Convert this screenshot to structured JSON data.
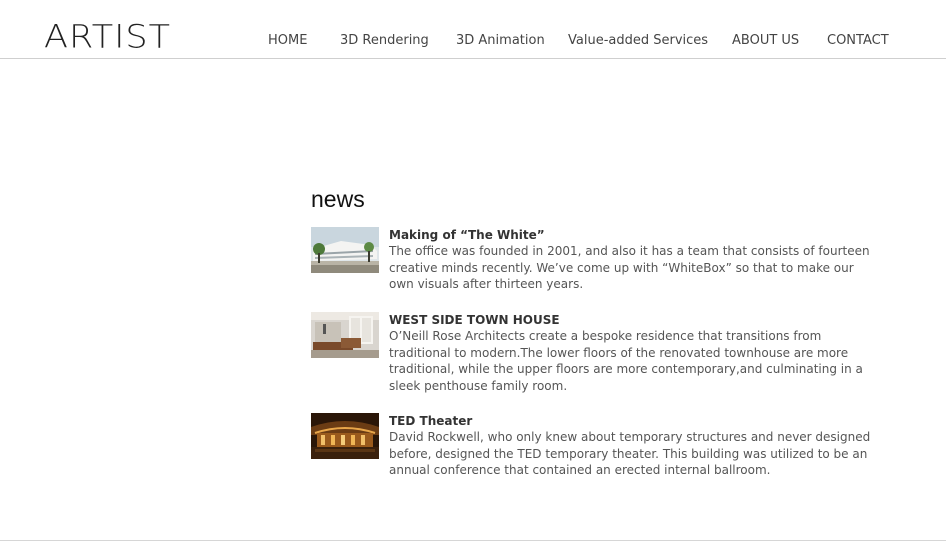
{
  "header": {
    "logo": "ARTIST",
    "nav": [
      {
        "label": "HOME"
      },
      {
        "label": "3D Rendering"
      },
      {
        "label": "3D Animation"
      },
      {
        "label": "Value-added Services"
      },
      {
        "label": "ABOUT US"
      },
      {
        "label": "CONTACT"
      }
    ]
  },
  "main": {
    "title": "news",
    "items": [
      {
        "title": "Making of “The White”",
        "text": "The office was founded in 2001, and also it has a team that consists of fourteen creative minds recently. We’ve come up with “WhiteBox” so that to make our own visuals after thirteen years."
      },
      {
        "title": "WEST SIDE TOWN HOUSE",
        "text": "O’Neill Rose Architects create a bespoke residence that transitions from traditional to modern.The lower floors of the renovated townhouse are more traditional, while the upper floors are more contemporary,and culminating in a sleek penthouse family room."
      },
      {
        "title": "TED Theater",
        "text": "David Rockwell, who only knew about temporary structures and never designed before, designed the TED temporary theater. This building was utilized to be an annual conference that contained an erected internal ballroom."
      }
    ]
  }
}
